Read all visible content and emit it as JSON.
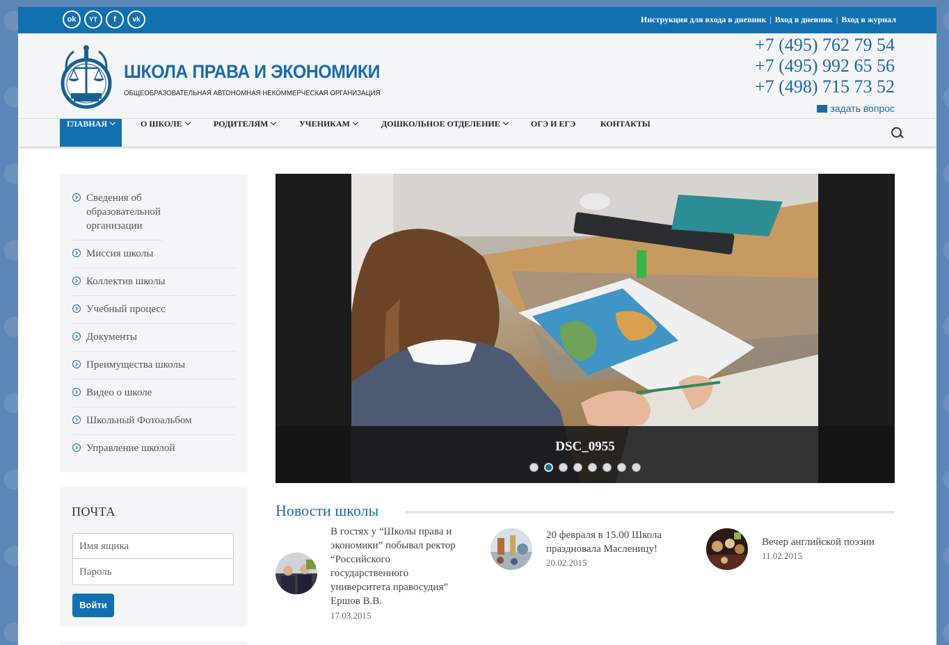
{
  "topbar": {
    "social": [
      {
        "icon": "odnoklassniki-icon",
        "glyph": "ok"
      },
      {
        "icon": "youtube-icon",
        "glyph": "YT"
      },
      {
        "icon": "facebook-icon",
        "glyph": "f"
      },
      {
        "icon": "vk-icon",
        "glyph": "vk"
      }
    ],
    "links": [
      "Инструкция для входа в дневник",
      "Вход в дневник",
      "Вход в журнал"
    ],
    "separator": "|"
  },
  "header": {
    "name": "ШКОЛА ПРАВА И ЭКОНОМИКИ",
    "subtitle": "ОБЩЕОБРАЗОВАТЕЛЬНАЯ АВТОНОМНАЯ НЕКОММЕРЧЕСКАЯ ОРГАНИЗАЦИЯ",
    "phones": [
      "+7 (495) 762 79 54",
      "+7 (495) 992 65 56",
      "+7 (498) 715 73 52"
    ],
    "ask": "задать вопрос"
  },
  "nav": {
    "items": [
      "ГЛАВНАЯ",
      "О ШКОЛЕ",
      "РОДИТЕЛЯМ",
      "УЧЕНИКАМ",
      "ДОШКОЛЬНОЕ ОТДЕЛЕНИЕ",
      "ОГЭ И ЕГЭ",
      "КОНТАКТЫ"
    ]
  },
  "sidebar": {
    "items": [
      "Сведения об образовательной организации",
      "Миссия школы",
      "Коллектив школы",
      "Учебный процесс",
      "Документы",
      "Преимущества школы",
      "Видео о школе",
      "Школьный Фотоальбом",
      "Управление школой"
    ]
  },
  "mail": {
    "title": "ПОЧТА",
    "box_placeholder": "Имя ящика",
    "password_placeholder": "Пароль",
    "login": "Войти"
  },
  "slider": {
    "caption": "DSC_0955",
    "dots": 8,
    "active": 1
  },
  "news": {
    "title": "Новости школы",
    "items": [
      {
        "text": "В гостях у “Школы права и экономики” побывал ректор “Российского государственного университета правосудия” Ершов В.В.",
        "date": "17.03.2015"
      },
      {
        "text": "20 февраля в 15.00 Школа праздновала Масленицу!",
        "date": "20.02.2015"
      },
      {
        "text": "Вечер английской поэзии",
        "date": "11.02.2015"
      }
    ]
  },
  "colors": {
    "brand": "#1270b0",
    "text_blue": "#1a6aa8",
    "panel": "#f4f5f7"
  }
}
